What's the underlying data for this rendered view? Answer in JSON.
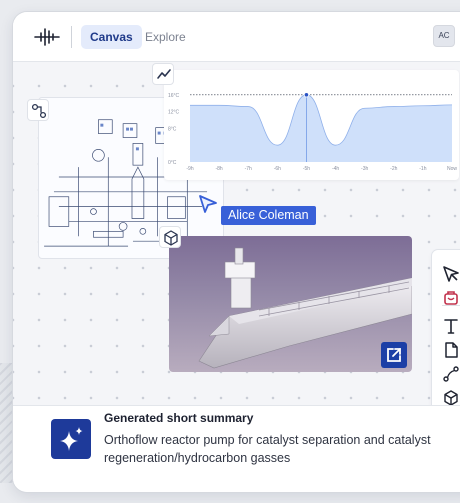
{
  "topbar": {
    "tabs": [
      {
        "label": "Canvas",
        "active": true
      },
      {
        "label": "Explore",
        "active": false
      }
    ],
    "avatar_initials": "AC"
  },
  "chart_data": {
    "type": "area",
    "x": [
      "-9h",
      "-8h",
      "-7h",
      "-6h",
      "-5h",
      "-4h",
      "-3h",
      "-2h",
      "-1h",
      "Now"
    ],
    "y_ticks": [
      "16°C",
      "12°C",
      "8°C",
      "0°C"
    ],
    "series": [
      {
        "values": [
          13.5,
          13.5,
          13.2,
          4,
          16,
          4,
          12.8,
          13.2,
          13.4,
          13.6
        ]
      }
    ],
    "reference_line": 16,
    "highlight_point": {
      "x": "-5h",
      "y": 16
    },
    "color": "#3b6fd9",
    "fill": "#cfe0fa"
  },
  "collaborator": {
    "name": "Alice Coleman",
    "color": "#3860d8"
  },
  "tools": [
    "pointer-icon",
    "delete-icon",
    "text-icon",
    "document-icon",
    "connector-icon",
    "cube-icon",
    "comment-icon"
  ],
  "summary": {
    "title": "Generated short summary",
    "text": "Orthoflow reactor pump for catalyst separation and catalyst regeneration/hydrocarbon gasses"
  },
  "colors": {
    "accent": "#1e3a9a",
    "highlight": "#3860d8"
  }
}
